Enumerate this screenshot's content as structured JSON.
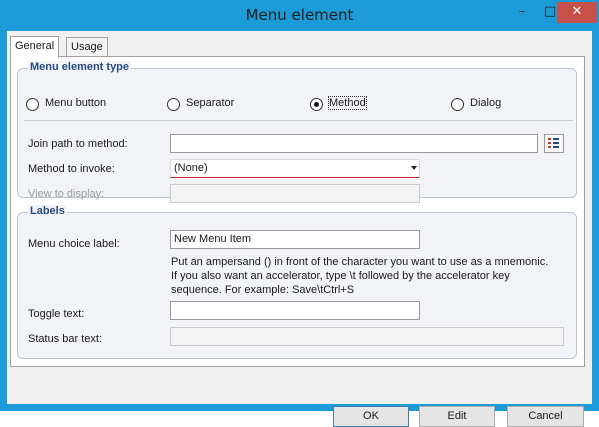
{
  "window": {
    "title": "Menu element"
  },
  "tabs": [
    {
      "label": "General"
    },
    {
      "label": "Usage"
    }
  ],
  "type_group": {
    "title": "Menu element type",
    "options": [
      {
        "label": "Menu button",
        "checked": false
      },
      {
        "label": "Separator",
        "checked": false
      },
      {
        "label": "Method",
        "checked": true
      },
      {
        "label": "Dialog",
        "checked": false
      }
    ],
    "join_path_label": "Join path to method:",
    "join_path_value": "",
    "method_label": "Method to invoke:",
    "method_value": "(None)",
    "view_label": "View to display:",
    "view_value": ""
  },
  "labels_group": {
    "title": "Labels",
    "menu_choice_label": "Menu choice label:",
    "menu_choice_value": "New Menu Item",
    "hint_lines": [
      "Put an ampersand () in front of the character you want to use as a mnemonic.",
      "If you also want an accelerator, type \\t followed by the accelerator key",
      "sequence.  For example: Save\\tCtrl+S"
    ],
    "toggle_label": "Toggle text:",
    "toggle_value": "",
    "status_label": "Status bar text:",
    "status_value": ""
  },
  "buttons": {
    "ok": "OK",
    "edit": "Edit",
    "cancel": "Cancel"
  },
  "icons": {
    "minimize": "minimize-icon",
    "maximize": "maximize-icon",
    "close": "close-icon",
    "browse": "method-tree-icon"
  },
  "colors": {
    "titlebar": "#1b9bd8",
    "close": "#c7504b",
    "group_title": "#2b4a80"
  }
}
